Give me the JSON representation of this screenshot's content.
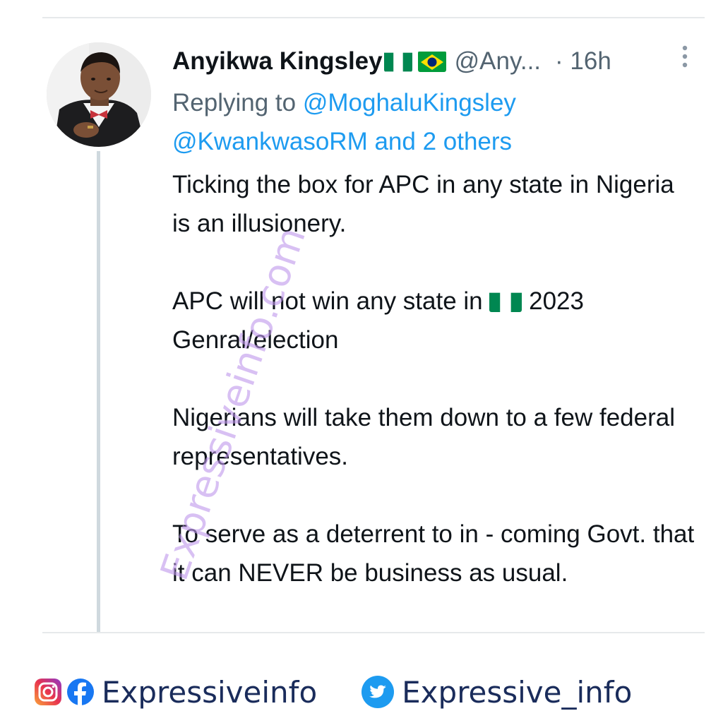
{
  "tweet": {
    "display_name": "Anyikwa Kingsley",
    "handle": "@Any...",
    "timestamp": "· 16h",
    "replying_prefix": "Replying to",
    "replying_mention_1": "@MoghaluKingsley",
    "replying_mention_2": "@KwankwasoRM",
    "replying_others": "and 2 others",
    "body": {
      "p1": "Ticking the box for APC in any state in Nigeria is an illusionery.",
      "p2_before": "APC will not win any state in",
      "p2_after": "2023 Genral/election",
      "p3": "Nigerians will take them down to a few federal representatives.",
      "p4": "To serve as a deterrent to in - coming Govt. that it can NEVER be business as usual."
    },
    "flags": [
      "nigeria-flag",
      "brazil-flag"
    ],
    "more_icon": "vertical-ellipsis-icon"
  },
  "watermark": "Expressiveinfo.com",
  "footer": {
    "left_label": "Expressiveinfo",
    "left_icons": [
      "instagram-icon",
      "facebook-icon"
    ],
    "right_label": "Expressive_info",
    "right_icon": "twitter-icon"
  },
  "colors": {
    "text": "#0f1419",
    "muted": "#536471",
    "link": "#1d9bf0",
    "thread_line": "#cfd9de",
    "footer_text": "#1a2c5b",
    "watermark": "#be96eb"
  }
}
